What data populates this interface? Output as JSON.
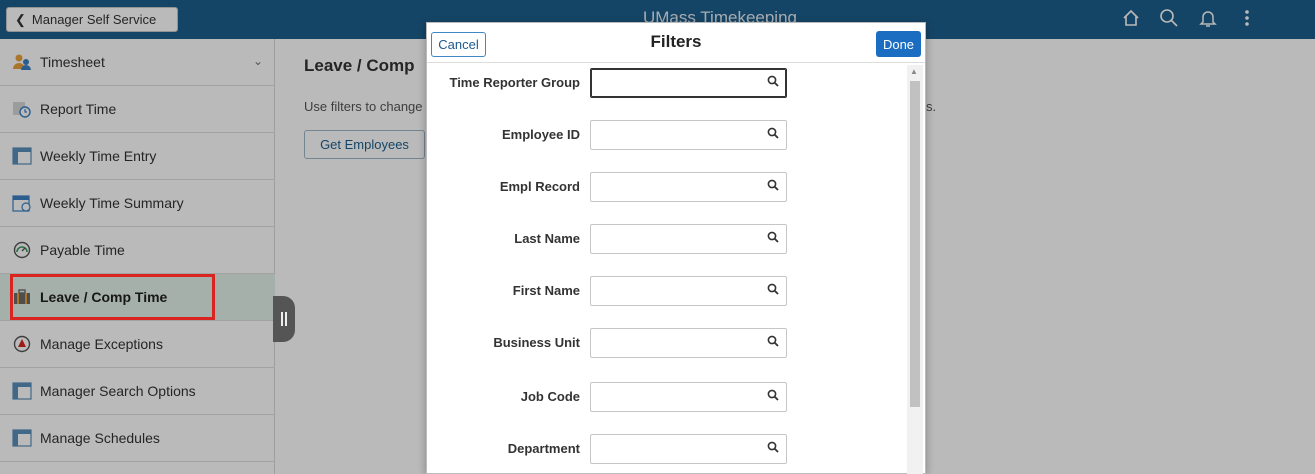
{
  "header": {
    "back_label": "Manager Self Service",
    "title": "UMass Timekeeping",
    "icons": [
      "home-icon",
      "search-icon",
      "bell-icon",
      "more-icon"
    ]
  },
  "sidebar": {
    "items": [
      {
        "label": "Timesheet",
        "icon": "people-icon"
      },
      {
        "label": "Report Time",
        "icon": "clock-icon"
      },
      {
        "label": "Weekly Time Entry",
        "icon": "grid-icon"
      },
      {
        "label": "Weekly Time Summary",
        "icon": "calendar-icon"
      },
      {
        "label": "Payable Time",
        "icon": "gauge-icon"
      },
      {
        "label": "Leave / Comp Time",
        "icon": "suitcase-icon"
      },
      {
        "label": "Manage Exceptions",
        "icon": "alert-icon"
      },
      {
        "label": "Manager Search Options",
        "icon": "grid-icon"
      },
      {
        "label": "Manage Schedules",
        "icon": "grid-icon"
      }
    ]
  },
  "main": {
    "title": "Leave / Comp",
    "instructions": "Use filters to change",
    "instructions_tail": "s.",
    "get_employees_label": "Get Employees"
  },
  "modal": {
    "cancel_label": "Cancel",
    "title": "Filters",
    "done_label": "Done",
    "fields": [
      {
        "label": "Time Reporter Group",
        "value": ""
      },
      {
        "label": "Employee ID",
        "value": ""
      },
      {
        "label": "Empl Record",
        "value": ""
      },
      {
        "label": "Last Name",
        "value": ""
      },
      {
        "label": "First Name",
        "value": ""
      },
      {
        "label": "Business Unit",
        "value": ""
      },
      {
        "label": "Job Code",
        "value": ""
      },
      {
        "label": "Department",
        "value": ""
      }
    ]
  }
}
